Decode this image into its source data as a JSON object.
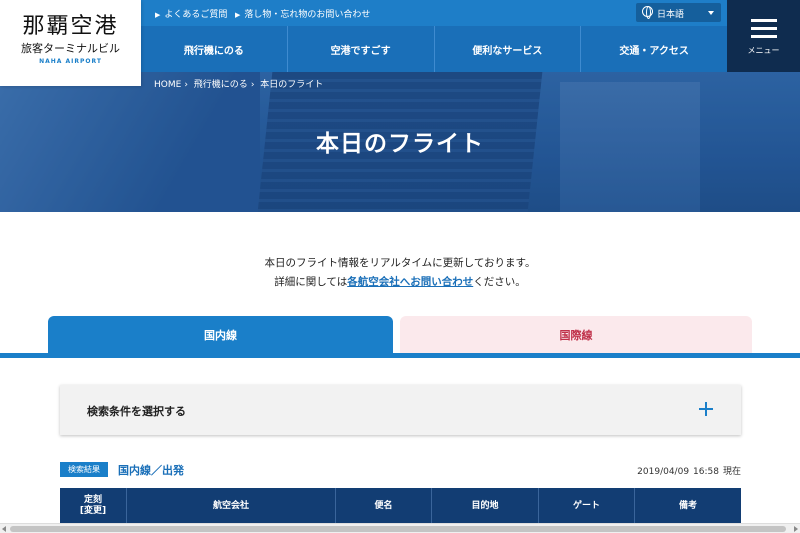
{
  "header": {
    "logo_main": "那覇空港",
    "logo_sub": "旅客ターミナルビル",
    "logo_en": "NAHA AIRPORT",
    "top_links": [
      "よくあるご質問",
      "落し物・忘れ物のお問い合わせ"
    ],
    "language": "日本語",
    "nav": [
      "飛行機にのる",
      "空港ですごす",
      "便利なサービス",
      "交通・アクセス"
    ],
    "menu_label": "メニュー"
  },
  "hero": {
    "breadcrumb": [
      "HOME",
      "飛行機にのる",
      "本日のフライト"
    ],
    "title": "本日のフライト"
  },
  "intro": {
    "line1": "本日のフライト情報をリアルタイムに更新しております。",
    "line2_prefix": "詳細に関しては",
    "line2_link": "各航空会社へお問い合わせ",
    "line2_suffix": "ください。"
  },
  "tabs": {
    "domestic": "国内線",
    "international": "国際線"
  },
  "search": {
    "label": "検索条件を選択する"
  },
  "results": {
    "badge": "検索結果",
    "title": "国内線／出発",
    "date": "2019/04/09",
    "time": "16:58",
    "suffix": "現在",
    "columns": [
      "定刻",
      "[変更]",
      "航空会社",
      "便名",
      "目的地",
      "ゲート",
      "備考"
    ]
  },
  "colors": {
    "primary": "#1a7fc9",
    "nav": "#1a6fb8",
    "table_header": "#123d73",
    "menu_bg": "#0f2c4f",
    "intl_tab_bg": "#fbe9ec",
    "intl_tab_text": "#c0314a"
  }
}
